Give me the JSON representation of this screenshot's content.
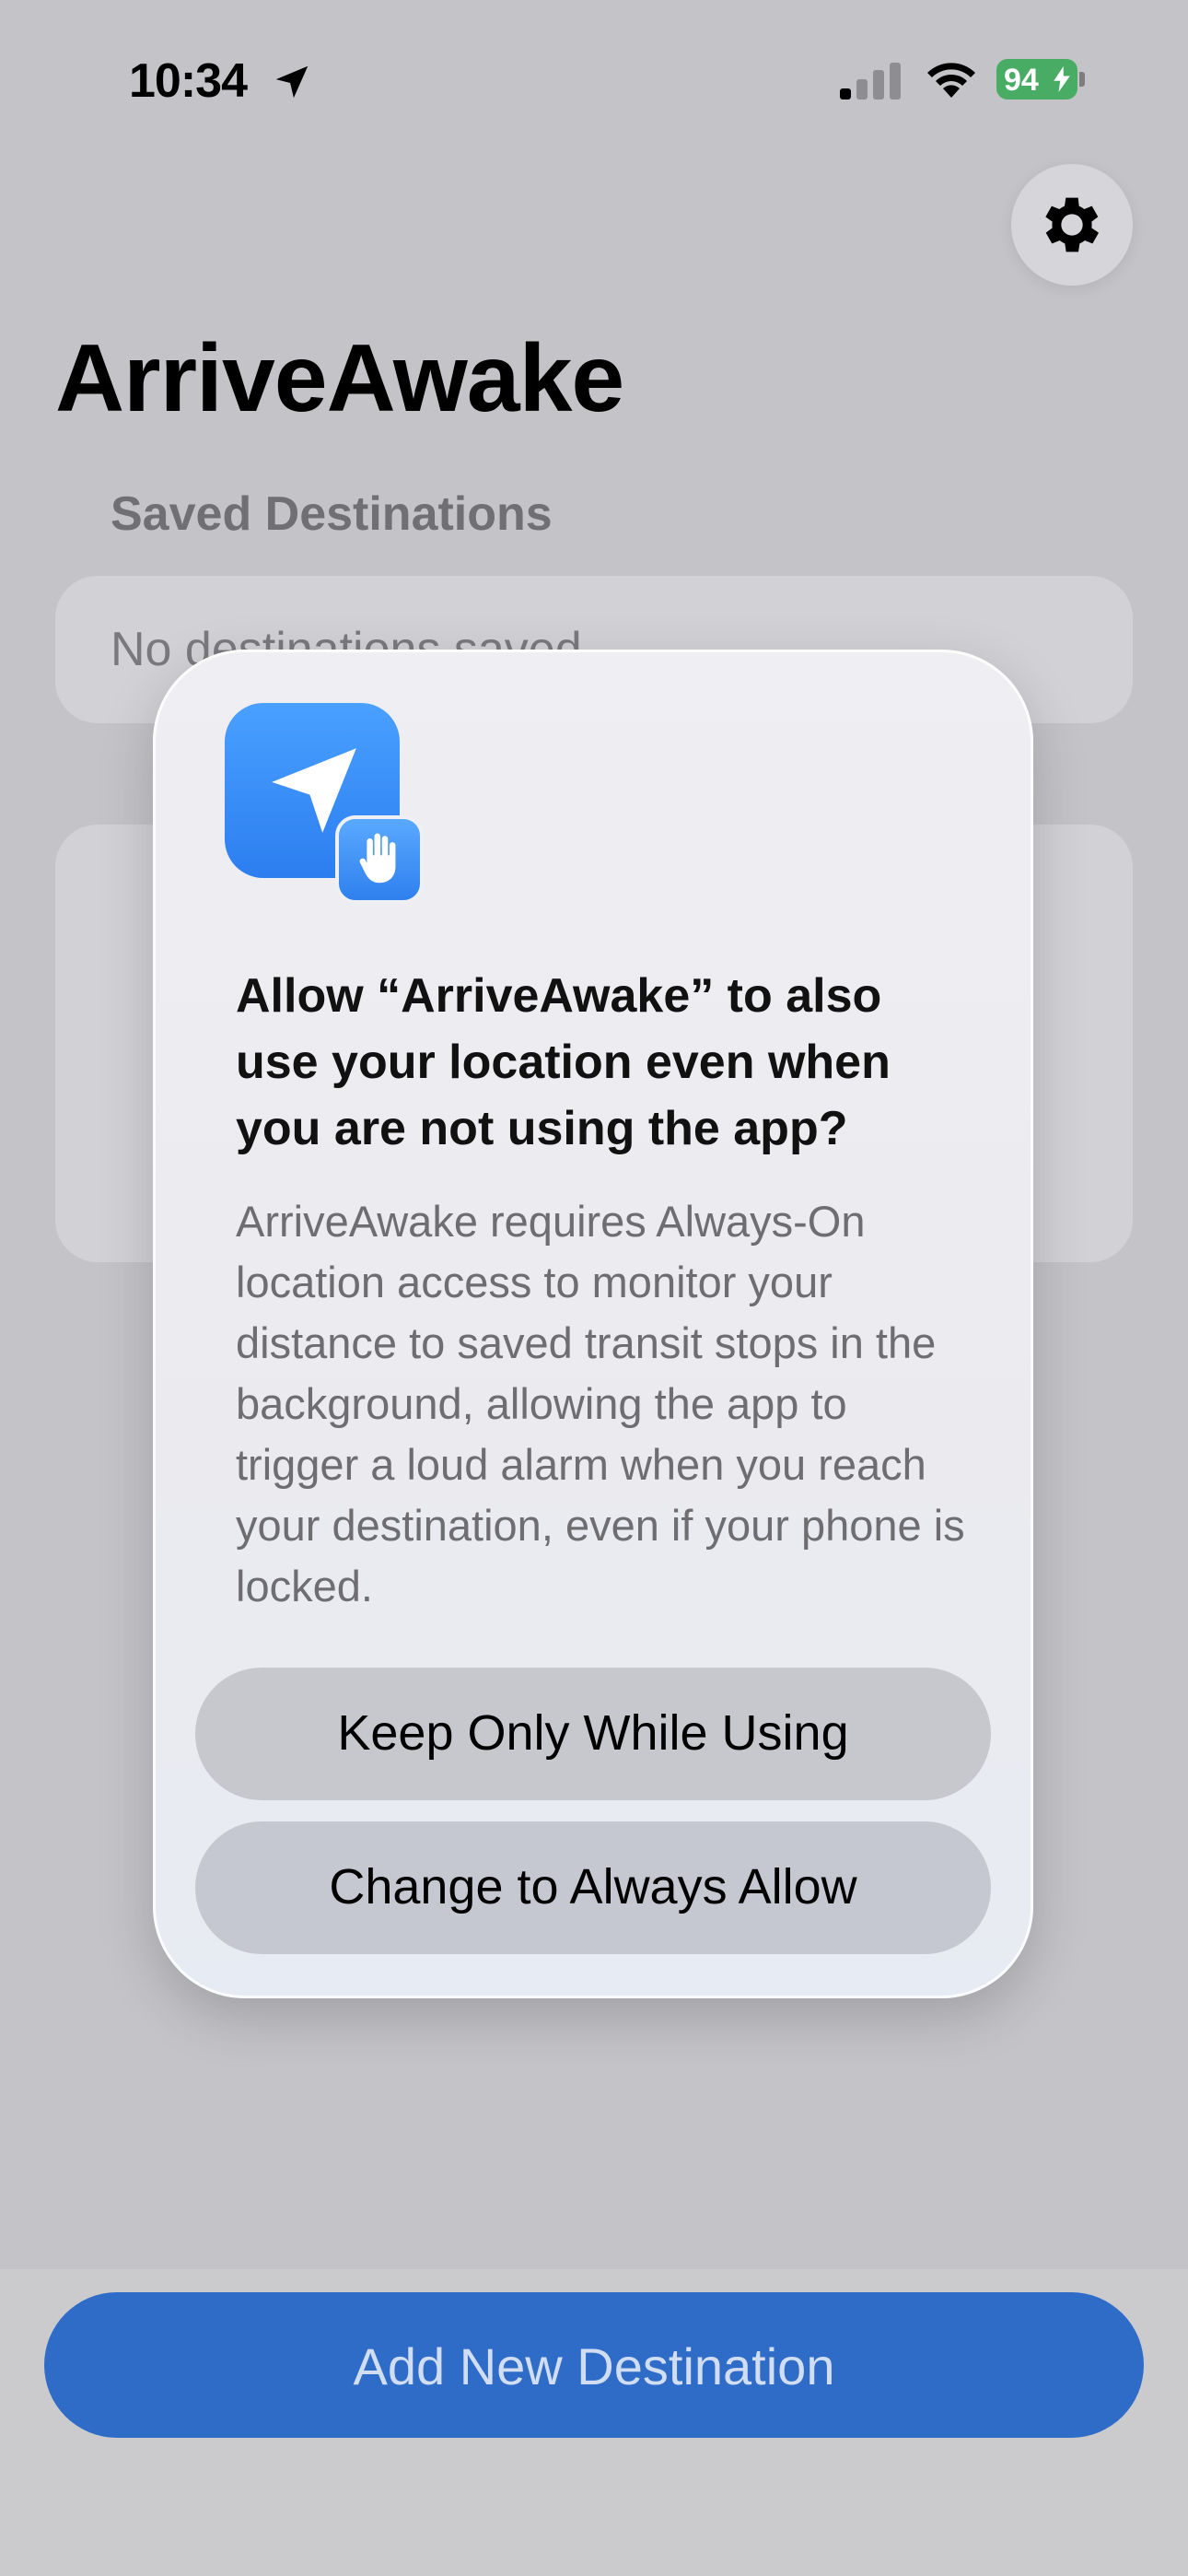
{
  "status_bar": {
    "time": "10:34",
    "battery_level": "94",
    "icons": [
      "location-arrow-icon",
      "cellular-signal-icon",
      "wifi-icon",
      "battery-charging-icon"
    ]
  },
  "app": {
    "title": "ArriveAwake",
    "settings_icon": "gear-icon"
  },
  "saved_destinations": {
    "header": "Saved Destinations",
    "empty_text": "No destinations saved"
  },
  "alert": {
    "icon": "location-arrow-icon",
    "badge_icon": "hand-icon",
    "title": "Allow “ArriveAwake” to also use your location even when you are not using the app?",
    "message": "ArriveAwake requires Always-On location access to monitor your distance to saved transit stops in the background, allowing the app to trigger a loud alarm when you reach your destination, even if your phone is locked.",
    "buttons": {
      "keep": "Keep Only While Using",
      "always": "Change to Always Allow"
    }
  },
  "bottom": {
    "add_button": "Add New Destination"
  },
  "colors": {
    "accent": "#2f6cc8",
    "dim_background": "#c4c4c8",
    "app_icon": "#2c7ef0"
  }
}
